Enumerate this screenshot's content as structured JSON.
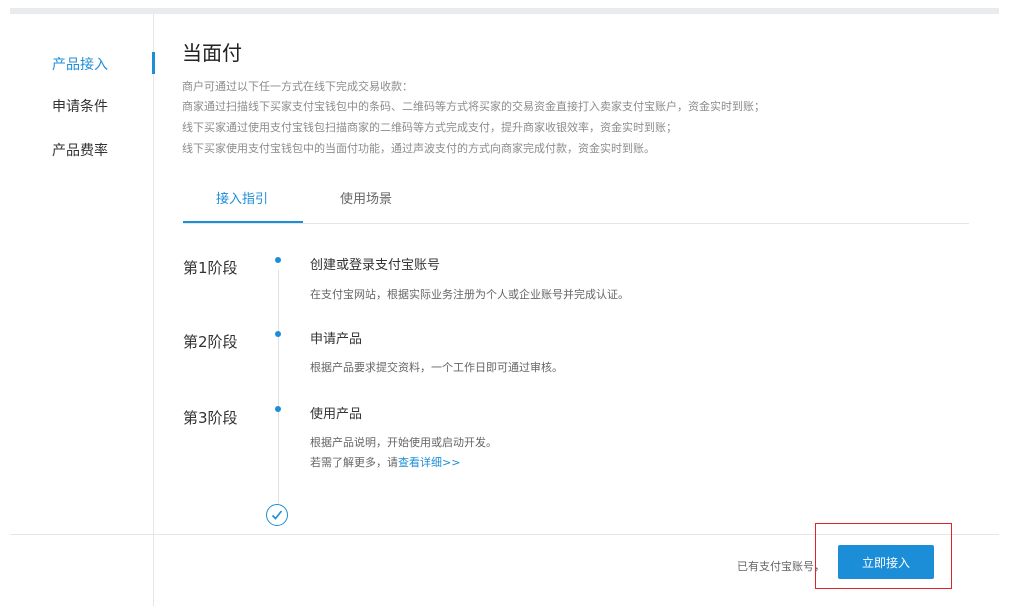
{
  "sidebar": {
    "items": [
      {
        "label": "产品接入",
        "active": true
      },
      {
        "label": "申请条件",
        "active": false
      },
      {
        "label": "产品费率",
        "active": false
      }
    ]
  },
  "main": {
    "title": "当面付",
    "description": [
      "商户可通过以下任一方式在线下完成交易收款：",
      "商家通过扫描线下买家支付宝钱包中的条码、二维码等方式将买家的交易资金直接打入卖家支付宝账户，资金实时到账；",
      "线下买家通过使用支付宝钱包扫描商家的二维码等方式完成支付，提升商家收银效率，资金实时到账；",
      "线下买家使用支付宝钱包中的当面付功能，通过声波支付的方式向商家完成付款，资金实时到账。"
    ],
    "tabs": [
      {
        "label": "接入指引",
        "active": true
      },
      {
        "label": "使用场景",
        "active": false
      }
    ],
    "steps": [
      {
        "stage": "第1阶段",
        "title": "创建或登录支付宝账号",
        "desc": "在支付宝网站，根据实际业务注册为个人或企业账号并完成认证。"
      },
      {
        "stage": "第2阶段",
        "title": "申请产品",
        "desc": "根据产品要求提交资料，一个工作日即可通过审核。"
      },
      {
        "stage": "第3阶段",
        "title": "使用产品",
        "desc": "根据产品说明，开始使用或启动开发。",
        "more_prefix": "若需了解更多，请",
        "more_link": "查看详细>>"
      }
    ]
  },
  "footer": {
    "hint": "已有支付宝账号，",
    "cta_label": "立即接入"
  },
  "colors": {
    "accent": "#1c8ed8",
    "highlight": "#d9262b"
  }
}
